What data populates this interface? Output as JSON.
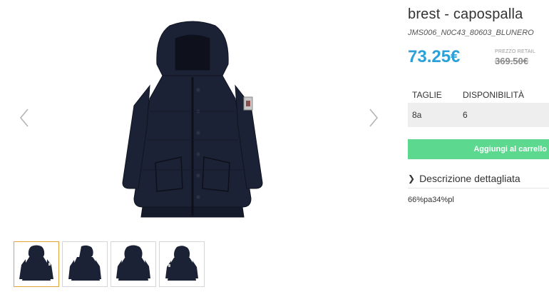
{
  "product": {
    "title": "brest - capospalla",
    "sku": "JMS006_N0C43_80603_BLUNERO",
    "price": "73.25€",
    "retail_label": "PREZZO RETAIL",
    "retail_price": "369.50€"
  },
  "sizes": {
    "headers": {
      "size": "TAGLIE",
      "availability": "DISPONIBILITÀ"
    },
    "rows": [
      {
        "size": "8a",
        "availability": "6"
      }
    ]
  },
  "actions": {
    "add_to_cart": "Aggiungi al carrello"
  },
  "description": {
    "toggle_label": "Descrizione dettagliata",
    "text": "66%pa34%pl"
  },
  "gallery": {
    "prev_icon": "chevron-left-icon",
    "next_icon": "chevron-right-icon",
    "thumbnails": [
      "jacket-front",
      "jacket-front-side",
      "jacket-back",
      "jacket-back-side"
    ],
    "active_thumbnail": 0
  },
  "colors": {
    "price": "#2ba1d8",
    "button": "#5cd88f",
    "active_thumb_border": "#e6a13b",
    "jacket": "#1c2235"
  }
}
